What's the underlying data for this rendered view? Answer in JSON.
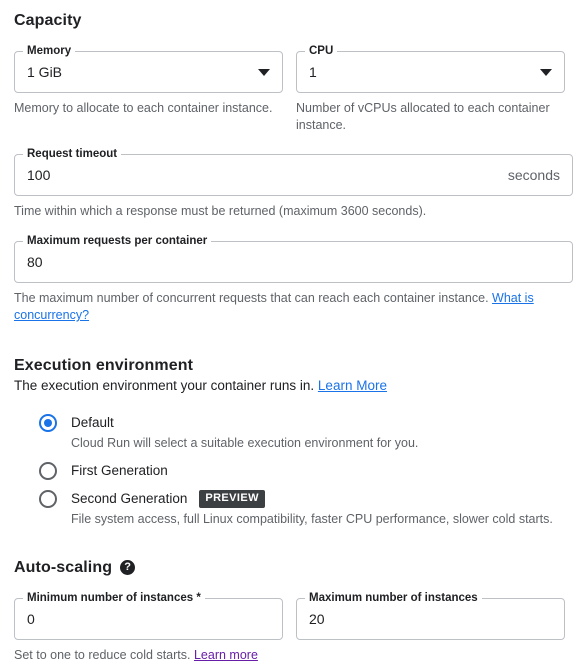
{
  "capacity": {
    "title": "Capacity",
    "memory": {
      "label": "Memory",
      "value": "1 GiB",
      "helper": "Memory to allocate to each container instance.",
      "icon": "chevron-down-icon"
    },
    "cpu": {
      "label": "CPU",
      "value": "1",
      "helper": "Number of vCPUs allocated to each container instance.",
      "icon": "chevron-down-icon"
    },
    "request_timeout": {
      "label": "Request timeout",
      "value": "100",
      "suffix": "seconds",
      "helper": "Time within which a response must be returned (maximum 3600 seconds)."
    },
    "max_requests": {
      "label": "Maximum requests per container",
      "value": "80",
      "helper_text": "The maximum number of concurrent requests that can reach each container instance. ",
      "helper_link": "What is concurrency?"
    }
  },
  "execution_environment": {
    "title": "Execution environment",
    "subtitle": "The execution environment your container runs in. ",
    "subtitle_link": "Learn More",
    "options": [
      {
        "label": "Default",
        "description": "Cloud Run will select a suitable execution environment for you.",
        "selected": true,
        "badge": ""
      },
      {
        "label": "First Generation",
        "description": "",
        "selected": false,
        "badge": ""
      },
      {
        "label": "Second Generation",
        "description": "File system access, full Linux compatibility, faster CPU performance, slower cold starts.",
        "selected": false,
        "badge": "PREVIEW"
      }
    ]
  },
  "autoscaling": {
    "title": "Auto-scaling",
    "help_icon": "help-circle-icon",
    "min_instances": {
      "label": "Minimum number of instances *",
      "value": "0",
      "helper_text": "Set to one to reduce cold starts. ",
      "helper_link": "Learn more"
    },
    "max_instances": {
      "label": "Maximum number of instances",
      "value": "20"
    }
  },
  "colors": {
    "accent": "#1a73e8",
    "visited_link": "#681da8",
    "badge_bg": "#3c4043",
    "border": "#bdc1c6",
    "text": "#202124",
    "muted": "#5f6368"
  }
}
